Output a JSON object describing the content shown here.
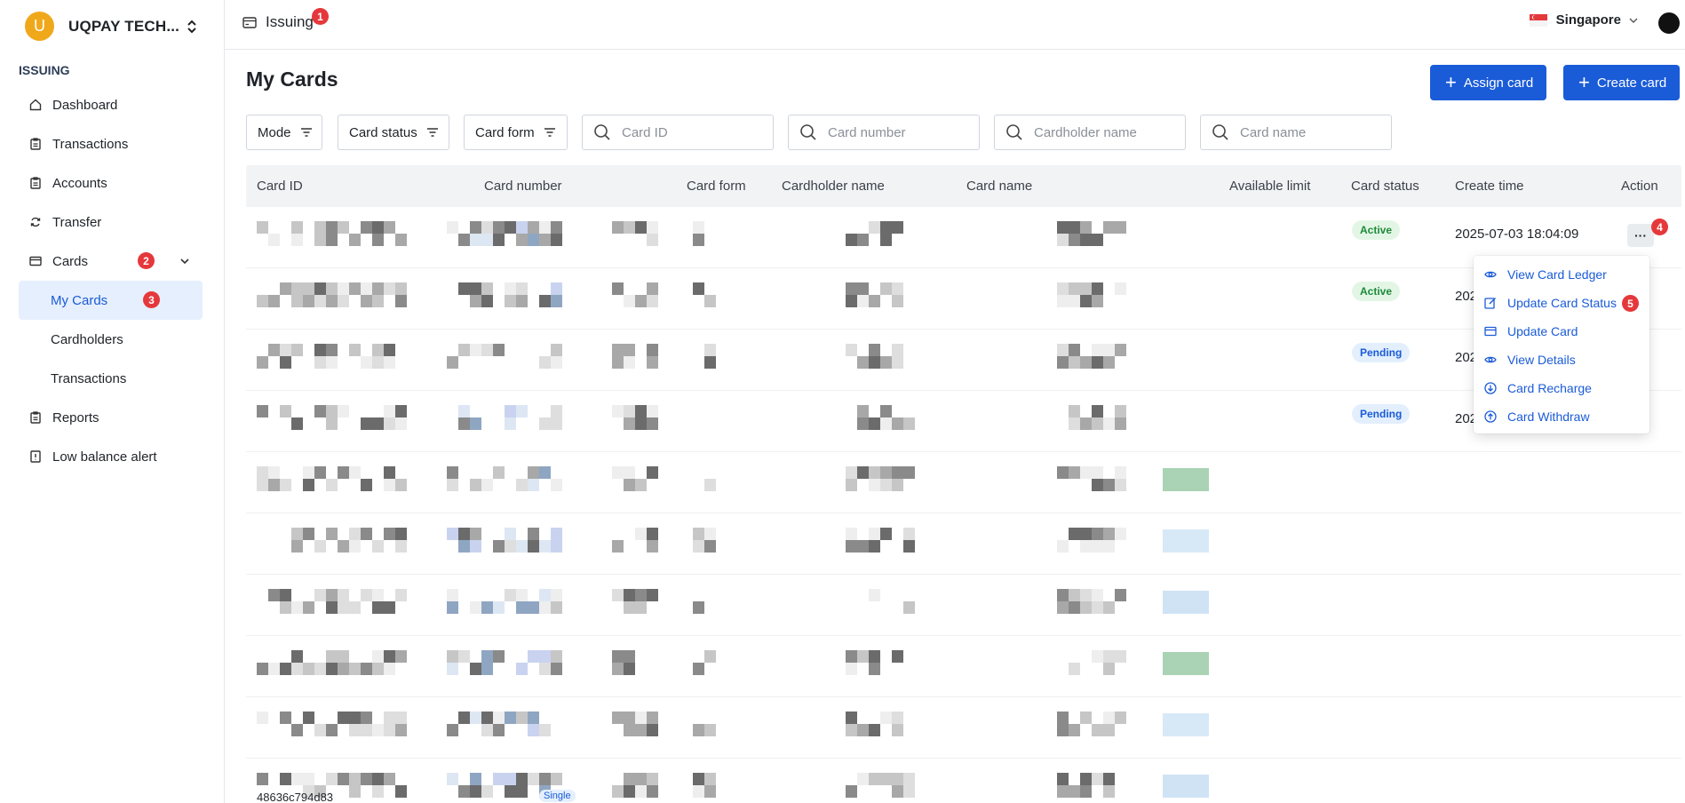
{
  "sidebar": {
    "org": {
      "initial": "U",
      "name": "UQPAY TECH..."
    },
    "section": "ISSUING",
    "items": [
      {
        "label": "Dashboard",
        "icon": "home-icon"
      },
      {
        "label": "Transactions",
        "icon": "clipboard-icon"
      },
      {
        "label": "Accounts",
        "icon": "clipboard-icon"
      },
      {
        "label": "Transfer",
        "icon": "transfer-icon"
      },
      {
        "label": "Cards",
        "icon": "card-icon",
        "badge": "2"
      },
      {
        "label": "My Cards",
        "badge": "3"
      },
      {
        "label": "Cardholders"
      },
      {
        "label": "Transactions"
      },
      {
        "label": "Reports",
        "icon": "clipboard-icon"
      },
      {
        "label": "Low balance alert",
        "icon": "alert-doc-icon"
      }
    ]
  },
  "topbar": {
    "title": "Issuing",
    "title_badge": "1",
    "region": "Singapore"
  },
  "page": {
    "title": "My Cards",
    "assign_label": "Assign card",
    "create_label": "Create card"
  },
  "filters": {
    "mode": "Mode",
    "card_status": "Card status",
    "card_form": "Card form",
    "card_id_placeholder": "Card ID",
    "card_number_placeholder": "Card number",
    "cardholder_placeholder": "Cardholder name",
    "card_name_placeholder": "Card name"
  },
  "table": {
    "columns": [
      "Card ID",
      "Card number",
      "Card form",
      "Cardholder name",
      "Card name",
      "Available limit",
      "Card status",
      "Create time",
      "Action"
    ],
    "rows": [
      {
        "status": "Active",
        "create_time": "2025-07-03 18:04:09",
        "action_badge": "4"
      },
      {
        "status": "Active",
        "create_time": "202"
      },
      {
        "status": "Pending",
        "create_time": "202"
      },
      {
        "status": "Pending",
        "create_time": "202"
      }
    ],
    "partial_row": {
      "card_id": "48636c794d83",
      "card_form": "Single"
    }
  },
  "action_menu": {
    "items": [
      {
        "label": "View Card Ledger",
        "icon": "eye-icon"
      },
      {
        "label": "Update Card Status",
        "icon": "edit-icon",
        "badge": "5"
      },
      {
        "label": "Update Card",
        "icon": "card-icon"
      },
      {
        "label": "View Details",
        "icon": "eye-icon"
      },
      {
        "label": "Card Recharge",
        "icon": "arrow-down-circle-icon"
      },
      {
        "label": "Card Withdraw",
        "icon": "arrow-up-circle-icon"
      }
    ]
  },
  "colors": {
    "primary": "#1a5bd8",
    "active_bg": "#e3f6e6",
    "pending_bg": "#e3effc",
    "badge": "#e5383b"
  }
}
